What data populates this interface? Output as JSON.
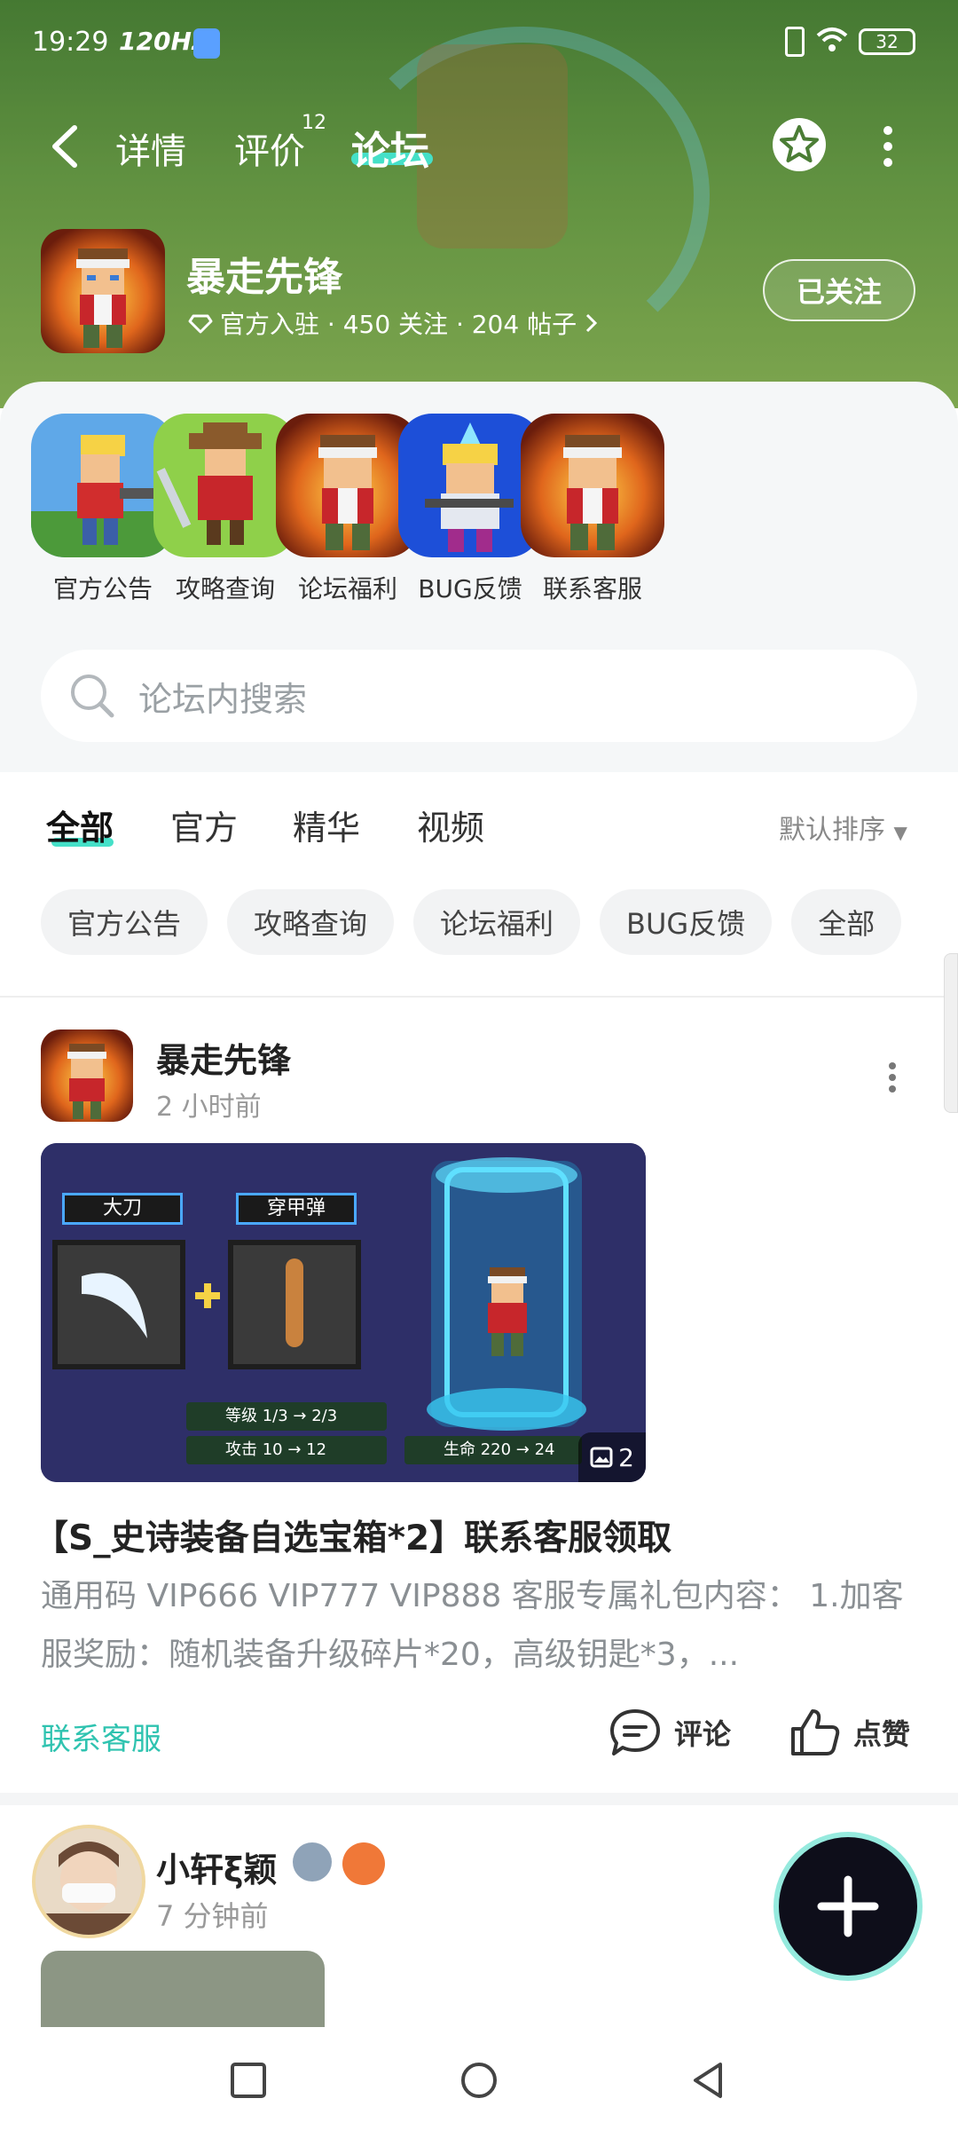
{
  "status_bar": {
    "time": "19:29",
    "refresh": "120Hz",
    "battery": "32"
  },
  "nav": {
    "tabs": [
      {
        "label": "详情"
      },
      {
        "label": "评价",
        "badge": "12"
      },
      {
        "label": "论坛",
        "active": true
      }
    ]
  },
  "game": {
    "name": "暴走先锋",
    "meta": "官方入驻 · 450 关注 · 204 帖子",
    "follow_label": "已关注"
  },
  "shortcuts": [
    {
      "label": "官方公告",
      "icon": "hero-gunner-icon"
    },
    {
      "label": "攻略查询",
      "icon": "cowboy-swordsman-icon"
    },
    {
      "label": "论坛福利",
      "icon": "headband-hero-icon"
    },
    {
      "label": "BUG反馈",
      "icon": "blonde-fighter-icon"
    },
    {
      "label": "联系客服",
      "icon": "headband-hero-icon"
    }
  ],
  "search": {
    "placeholder": "论坛内搜索"
  },
  "content_tabs": [
    "全部",
    "官方",
    "精华",
    "视频"
  ],
  "sort_label": "默认排序",
  "chips": [
    "官方公告",
    "攻略查询",
    "论坛福利",
    "BUG反馈",
    "全部"
  ],
  "post1": {
    "author": "暴走先锋",
    "time": "2 小时前",
    "image": {
      "tag_left": "大刀",
      "tag_mid": "穿甲弹",
      "stat1": "等级 1/3 → 2/3",
      "stat2": "攻击 10 → 12",
      "stat3": "生命 220 → 24",
      "count": "2"
    },
    "title": "【S_史诗装备自选宝箱*2】联系客服领取",
    "body": "通用码 VIP666 VIP777 VIP888 客服专属礼包内容： 1.加客服奖励：随机装备升级碎片*20，高级钥匙*3，...",
    "link": "联系客服",
    "comment_label": "评论",
    "like_label": "点赞"
  },
  "post2": {
    "author": "小轩ξ颖",
    "time": "7 分钟前"
  },
  "colors": {
    "accent": "#45e0c8",
    "link": "#2fc3b0",
    "header_green": "#6fa64a"
  }
}
